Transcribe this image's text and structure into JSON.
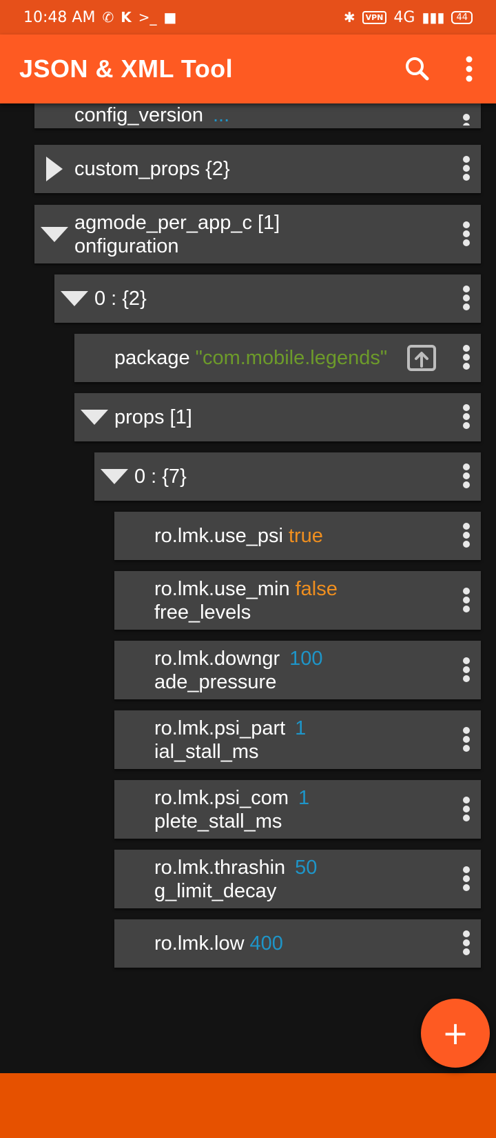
{
  "status_bar": {
    "time": "10:48 AM",
    "left_icons": [
      "whatsapp-icon",
      "k-icon",
      "terminal-icon",
      "cat-icon"
    ],
    "right_icons": [
      "bluetooth-icon",
      "vpn-icon",
      "signal-icon",
      "battery-icon"
    ],
    "vpn_label": "VPN",
    "network": "4G",
    "battery": "44"
  },
  "app_bar": {
    "title": "JSON & XML Tool",
    "icons": [
      "search-icon",
      "more-vert-icon"
    ]
  },
  "tree": {
    "nodes": [
      {
        "key": "config_version",
        "value": "...",
        "value_type": "number",
        "expanded": null
      },
      {
        "key": "custom_props",
        "count": "{2}",
        "expanded": false
      },
      {
        "key_line1": "agmode_per_app_c",
        "key_line2": "onfiguration",
        "count": "[1]",
        "expanded": true
      },
      {
        "key": "0 :",
        "count": "{2}",
        "expanded": true
      },
      {
        "key": "package",
        "value": "\"com.mobile.legends\"",
        "value_type": "string",
        "icon": "open-in-icon"
      },
      {
        "key": "props",
        "count": "[1]",
        "expanded": true
      },
      {
        "key": "0 :",
        "count": "{7}",
        "expanded": true
      },
      {
        "key": "ro.lmk.use_psi",
        "value": "true",
        "value_type": "boolean"
      },
      {
        "key_line1": "ro.lmk.use_min",
        "key_line2": "free_levels",
        "value": "false",
        "value_type": "boolean"
      },
      {
        "key_line1": "ro.lmk.downgr",
        "key_line2": "ade_pressure",
        "value": "100",
        "value_type": "number"
      },
      {
        "key_line1": "ro.lmk.psi_part",
        "key_line2": "ial_stall_ms",
        "value": "1",
        "value_type": "number"
      },
      {
        "key_line1": "ro.lmk.psi_com",
        "key_line2": "plete_stall_ms",
        "value": "1",
        "value_type": "number"
      },
      {
        "key_line1": "ro.lmk.thrashin",
        "key_line2": "g_limit_decay",
        "value": "50",
        "value_type": "number"
      },
      {
        "key": "ro.lmk.low",
        "value": "400",
        "value_type": "number"
      }
    ]
  },
  "fab": {
    "label": "+",
    "icon": "add-icon"
  },
  "colors": {
    "status_bar": "#e6501a",
    "app_bar": "#fe5a22",
    "background": "#131313",
    "row": "#434343",
    "string": "#6d9b2a",
    "boolean": "#f08f1f",
    "number": "#1e95c8",
    "bottom_bar": "#e65100"
  }
}
